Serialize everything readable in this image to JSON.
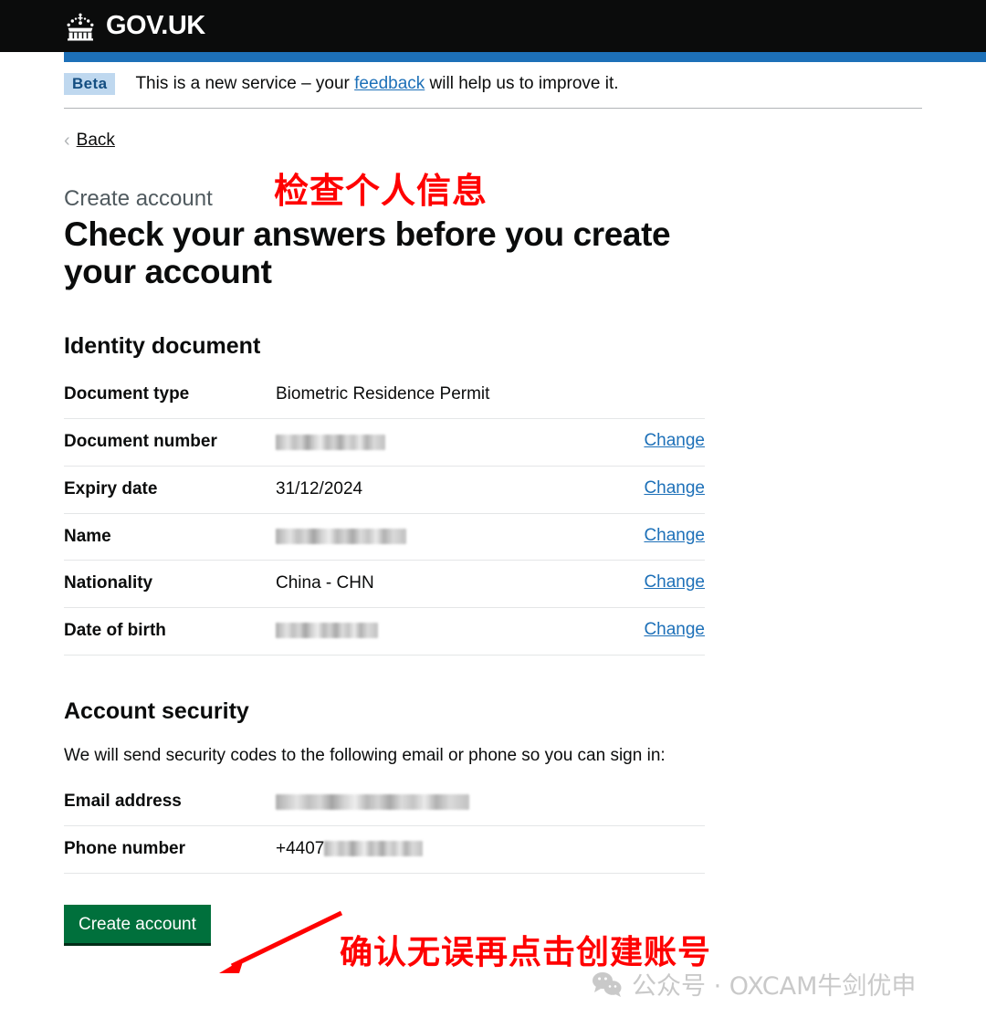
{
  "header": {
    "crown_icon": "crown-icon",
    "brand": "GOV.UK"
  },
  "phase_banner": {
    "tag": "Beta",
    "text_before": "This is a new service – your ",
    "link": "feedback",
    "text_after": " will help us to improve it."
  },
  "back_link": {
    "chevron": "‹",
    "label": "Back"
  },
  "main": {
    "caption": "Create account",
    "heading": "Check your answers before you create your account",
    "identity": {
      "heading": "Identity document",
      "rows": [
        {
          "key": "Document type",
          "value": "Biometric Residence Permit",
          "redacted": false,
          "action": ""
        },
        {
          "key": "Document number",
          "value": "",
          "redacted": true,
          "action": "Change"
        },
        {
          "key": "Expiry date",
          "value": "31/12/2024",
          "redacted": false,
          "action": "Change"
        },
        {
          "key": "Name",
          "value": "",
          "redacted": true,
          "action": "Change"
        },
        {
          "key": "Nationality",
          "value": "China - CHN",
          "redacted": false,
          "action": "Change"
        },
        {
          "key": "Date of birth",
          "value": "",
          "redacted": true,
          "action": "Change"
        }
      ]
    },
    "security": {
      "heading": "Account security",
      "intro": "We will send security codes to the following email or phone so you can sign in:",
      "rows": [
        {
          "key": "Email address",
          "value": "",
          "redacted": true,
          "action": ""
        },
        {
          "key": "Phone number",
          "value": "+4407",
          "redacted": true,
          "action": ""
        }
      ]
    },
    "submit_label": "Create account"
  },
  "annotations": {
    "top": "检查个人信息",
    "bottom": "确认无误再点击创建账号",
    "arrow_color": "#ff0000",
    "text_color": "#ff0000"
  },
  "watermark": {
    "icon": "wechat-icon",
    "text": "公众号 · OXCAM牛剑优申"
  },
  "colors": {
    "header_bg": "#0b0c0c",
    "blue_bar": "#1d70b8",
    "link": "#1d70b8",
    "button_green": "#00703c",
    "tag_bg": "#bfd8ef",
    "caption_grey": "#505a5f"
  }
}
